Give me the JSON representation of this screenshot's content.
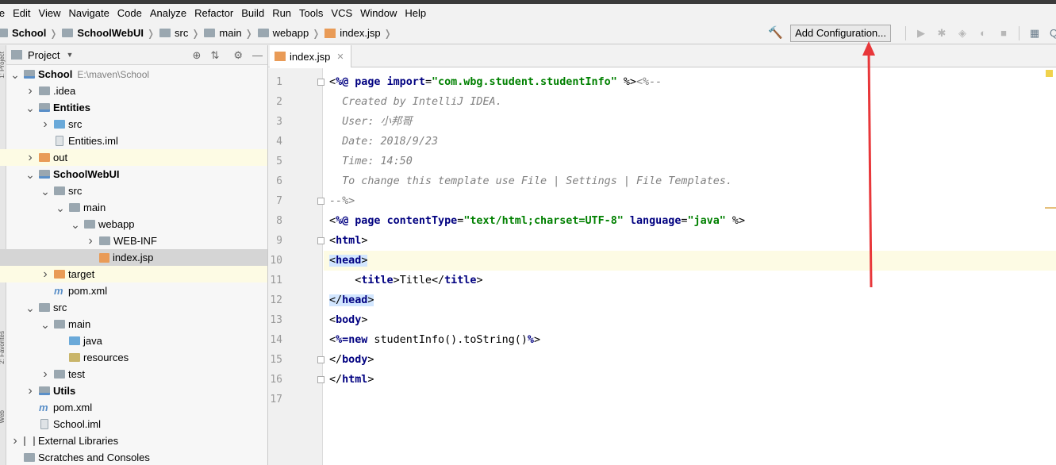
{
  "menu": [
    "le",
    "Edit",
    "View",
    "Navigate",
    "Code",
    "Analyze",
    "Refactor",
    "Build",
    "Run",
    "Tools",
    "VCS",
    "Window",
    "Help"
  ],
  "breadcrumbs": [
    {
      "label": "School",
      "bold": true,
      "icon": "module-folder-icon"
    },
    {
      "label": "SchoolWebUI",
      "bold": true,
      "icon": "module-folder-icon"
    },
    {
      "label": "src",
      "bold": false,
      "icon": "folder-icon"
    },
    {
      "label": "main",
      "bold": false,
      "icon": "folder-icon"
    },
    {
      "label": "webapp",
      "bold": false,
      "icon": "folder-icon"
    },
    {
      "label": "index.jsp",
      "bold": false,
      "icon": "jsp-file-icon"
    }
  ],
  "toolbar": {
    "add_configuration": "Add Configuration..."
  },
  "project": {
    "title": "Project",
    "tree": [
      {
        "depth": 0,
        "arrow": "open",
        "icon": "module",
        "label": "School",
        "bold": true,
        "path": "E:\\maven\\School",
        "hl": ""
      },
      {
        "depth": 1,
        "arrow": "closed",
        "icon": "folder",
        "label": ".idea",
        "bold": false,
        "hl": ""
      },
      {
        "depth": 1,
        "arrow": "open",
        "icon": "module",
        "label": "Entities",
        "bold": true,
        "hl": ""
      },
      {
        "depth": 2,
        "arrow": "closed",
        "icon": "blue",
        "label": "src",
        "bold": false,
        "hl": ""
      },
      {
        "depth": 2,
        "arrow": "none",
        "icon": "file",
        "label": "Entities.iml",
        "bold": false,
        "hl": ""
      },
      {
        "depth": 1,
        "arrow": "closed",
        "icon": "orange",
        "label": "out",
        "bold": false,
        "hl": "yellow"
      },
      {
        "depth": 1,
        "arrow": "open",
        "icon": "module",
        "label": "SchoolWebUI",
        "bold": true,
        "hl": ""
      },
      {
        "depth": 2,
        "arrow": "open",
        "icon": "folder",
        "label": "src",
        "bold": false,
        "hl": ""
      },
      {
        "depth": 3,
        "arrow": "open",
        "icon": "folder",
        "label": "main",
        "bold": false,
        "hl": ""
      },
      {
        "depth": 4,
        "arrow": "open",
        "icon": "folder",
        "label": "webapp",
        "bold": false,
        "hl": ""
      },
      {
        "depth": 5,
        "arrow": "closed",
        "icon": "folder",
        "label": "WEB-INF",
        "bold": false,
        "hl": ""
      },
      {
        "depth": 5,
        "arrow": "none",
        "icon": "jsp",
        "label": "index.jsp",
        "bold": false,
        "hl": "sel"
      },
      {
        "depth": 2,
        "arrow": "closed",
        "icon": "orange",
        "label": "target",
        "bold": false,
        "hl": "yellow"
      },
      {
        "depth": 2,
        "arrow": "none",
        "icon": "maven",
        "label": "pom.xml",
        "bold": false,
        "hl": ""
      },
      {
        "depth": 1,
        "arrow": "open",
        "icon": "folder",
        "label": "src",
        "bold": false,
        "hl": ""
      },
      {
        "depth": 2,
        "arrow": "open",
        "icon": "folder",
        "label": "main",
        "bold": false,
        "hl": ""
      },
      {
        "depth": 3,
        "arrow": "none",
        "icon": "blue",
        "label": "java",
        "bold": false,
        "hl": ""
      },
      {
        "depth": 3,
        "arrow": "none",
        "icon": "res",
        "label": "resources",
        "bold": false,
        "hl": ""
      },
      {
        "depth": 2,
        "arrow": "closed",
        "icon": "folder",
        "label": "test",
        "bold": false,
        "hl": ""
      },
      {
        "depth": 1,
        "arrow": "closed",
        "icon": "module",
        "label": "Utils",
        "bold": true,
        "hl": ""
      },
      {
        "depth": 1,
        "arrow": "none",
        "icon": "maven",
        "label": "pom.xml",
        "bold": false,
        "hl": ""
      },
      {
        "depth": 1,
        "arrow": "none",
        "icon": "file",
        "label": "School.iml",
        "bold": false,
        "hl": ""
      },
      {
        "depth": 0,
        "arrow": "closed",
        "icon": "lib",
        "label": "External Libraries",
        "bold": false,
        "hl": ""
      },
      {
        "depth": 0,
        "arrow": "none",
        "icon": "folder",
        "label": "Scratches and Consoles",
        "bold": false,
        "hl": ""
      }
    ]
  },
  "editor": {
    "tab_label": "index.jsp",
    "current_line": 10,
    "lines": [
      [
        [
          "d",
          "<"
        ],
        [
          "k",
          "%@ page "
        ],
        [
          "k",
          "import"
        ],
        [
          "d",
          "="
        ],
        [
          "s",
          "\"com.wbg.student.studentInfo\""
        ],
        [
          "d",
          " %>"
        ],
        [
          "c",
          "<%--"
        ]
      ],
      [
        [
          "c",
          "  Created by IntelliJ IDEA."
        ]
      ],
      [
        [
          "c",
          "  User: 小邦哥"
        ]
      ],
      [
        [
          "c",
          "  Date: 2018/9/23"
        ]
      ],
      [
        [
          "c",
          "  Time: 14:50"
        ]
      ],
      [
        [
          "c",
          "  To change this template use File | Settings | File Templates."
        ]
      ],
      [
        [
          "c",
          "--%>"
        ]
      ],
      [
        [
          "d",
          "<"
        ],
        [
          "k",
          "%@ page "
        ],
        [
          "k",
          "contentType"
        ],
        [
          "d",
          "="
        ],
        [
          "s",
          "\"text/html;charset=UTF-8\""
        ],
        [
          "d",
          " "
        ],
        [
          "k",
          "language"
        ],
        [
          "d",
          "="
        ],
        [
          "s",
          "\"java\""
        ],
        [
          "d",
          " %>"
        ]
      ],
      [
        [
          "d",
          "<"
        ],
        [
          "t",
          "html"
        ],
        [
          "d",
          ">"
        ]
      ],
      [
        [
          "tg",
          "<head>"
        ]
      ],
      [
        [
          "d",
          "    <"
        ],
        [
          "t",
          "title"
        ],
        [
          "d",
          ">"
        ],
        [
          "sv",
          "Title"
        ],
        [
          "d",
          "</"
        ],
        [
          "t",
          "title"
        ],
        [
          "d",
          ">"
        ]
      ],
      [
        [
          "tg",
          "</head>"
        ]
      ],
      [
        [
          "d",
          "<"
        ],
        [
          "t",
          "body"
        ],
        [
          "d",
          ">"
        ]
      ],
      [
        [
          "d",
          "<"
        ],
        [
          "k",
          "%="
        ],
        [
          "k",
          "new"
        ],
        [
          "sv",
          " studentInfo().toString()"
        ],
        [
          "k",
          "%"
        ],
        [
          "d",
          ">"
        ]
      ],
      [
        [
          "d",
          "</"
        ],
        [
          "t",
          "body"
        ],
        [
          "d",
          ">"
        ]
      ],
      [
        [
          "d",
          "</"
        ],
        [
          "t",
          "html"
        ],
        [
          "d",
          ">"
        ]
      ],
      []
    ]
  },
  "colors": {
    "arrow": "#e8373a",
    "current_line": "#fdfbe4",
    "keyword": "#000080",
    "string": "#008000",
    "comment": "#808080"
  }
}
